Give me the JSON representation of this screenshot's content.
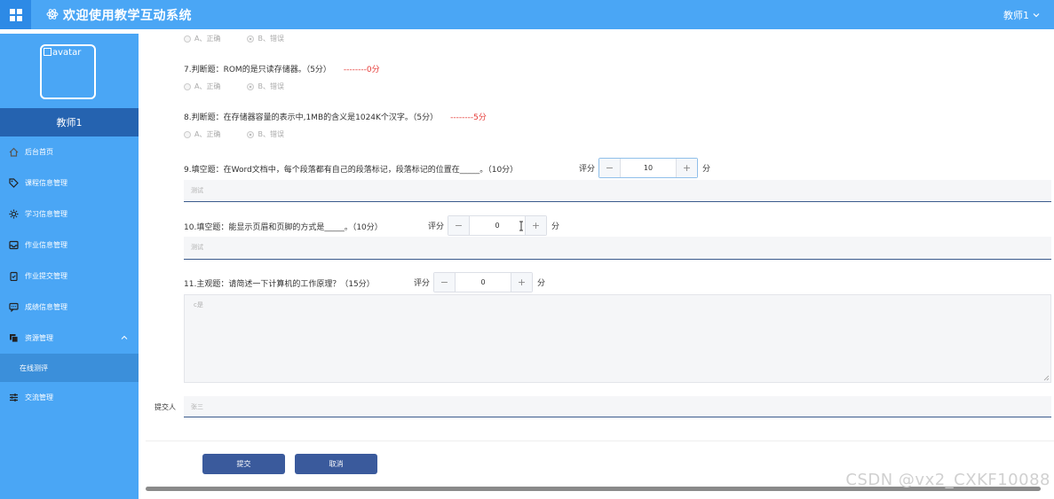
{
  "header": {
    "title": "欢迎使用教学互动系统",
    "user_label": "教师1"
  },
  "sidebar": {
    "avatar_alt": "avatar",
    "user_name": "教师1",
    "items": [
      {
        "label": "后台首页",
        "icon": "home-icon"
      },
      {
        "label": "课程信息管理",
        "icon": "tag-icon"
      },
      {
        "label": "学习信息管理",
        "icon": "gear-icon"
      },
      {
        "label": "作业信息管理",
        "icon": "inbox-icon"
      },
      {
        "label": "作业提交管理",
        "icon": "clipboard-icon"
      },
      {
        "label": "成绩信息管理",
        "icon": "chat-icon"
      },
      {
        "label": "资源管理",
        "icon": "copy-icon"
      },
      {
        "label": "交流管理",
        "icon": "sliders-icon"
      }
    ],
    "submenu": {
      "label": "在线测评"
    }
  },
  "questions": {
    "q6": {
      "option_a": "A、正确",
      "option_b": "B、错误"
    },
    "q7": {
      "text": "7.判断题：ROM的是只读存储器。（5分）",
      "score": "--------0分",
      "option_a": "A、正确",
      "option_b": "B、错误"
    },
    "q8": {
      "text": "8.判断题：在存储器容量的表示中,1MB的含义是1024K个汉字。（5分）",
      "score": "--------5分",
      "option_a": "A、正确",
      "option_b": "B、错误"
    },
    "q9": {
      "text": "9.填空题：在Word文档中，每个段落都有自己的段落标记，段落标记的位置在_____。（10分）",
      "score_label": "评分",
      "score_value": "10",
      "unit": "分",
      "answer": "测试"
    },
    "q10": {
      "text": "10.填空题：能显示页眉和页脚的方式是_____。（10分）",
      "score_label": "评分",
      "score_value": "0",
      "unit": "分",
      "answer": "测试"
    },
    "q11": {
      "text": "11.主观题：请简述一下计算机的工作原理？（15分）",
      "score_label": "评分",
      "score_value": "0",
      "unit": "分",
      "answer": "c是"
    }
  },
  "stepper": {
    "minus": "−",
    "plus": "+"
  },
  "submitter": {
    "label": "提交人",
    "value": "张三"
  },
  "buttons": {
    "submit": "提交",
    "cancel": "取消"
  },
  "watermark": "CSDN @vx2_CXKF10088"
}
